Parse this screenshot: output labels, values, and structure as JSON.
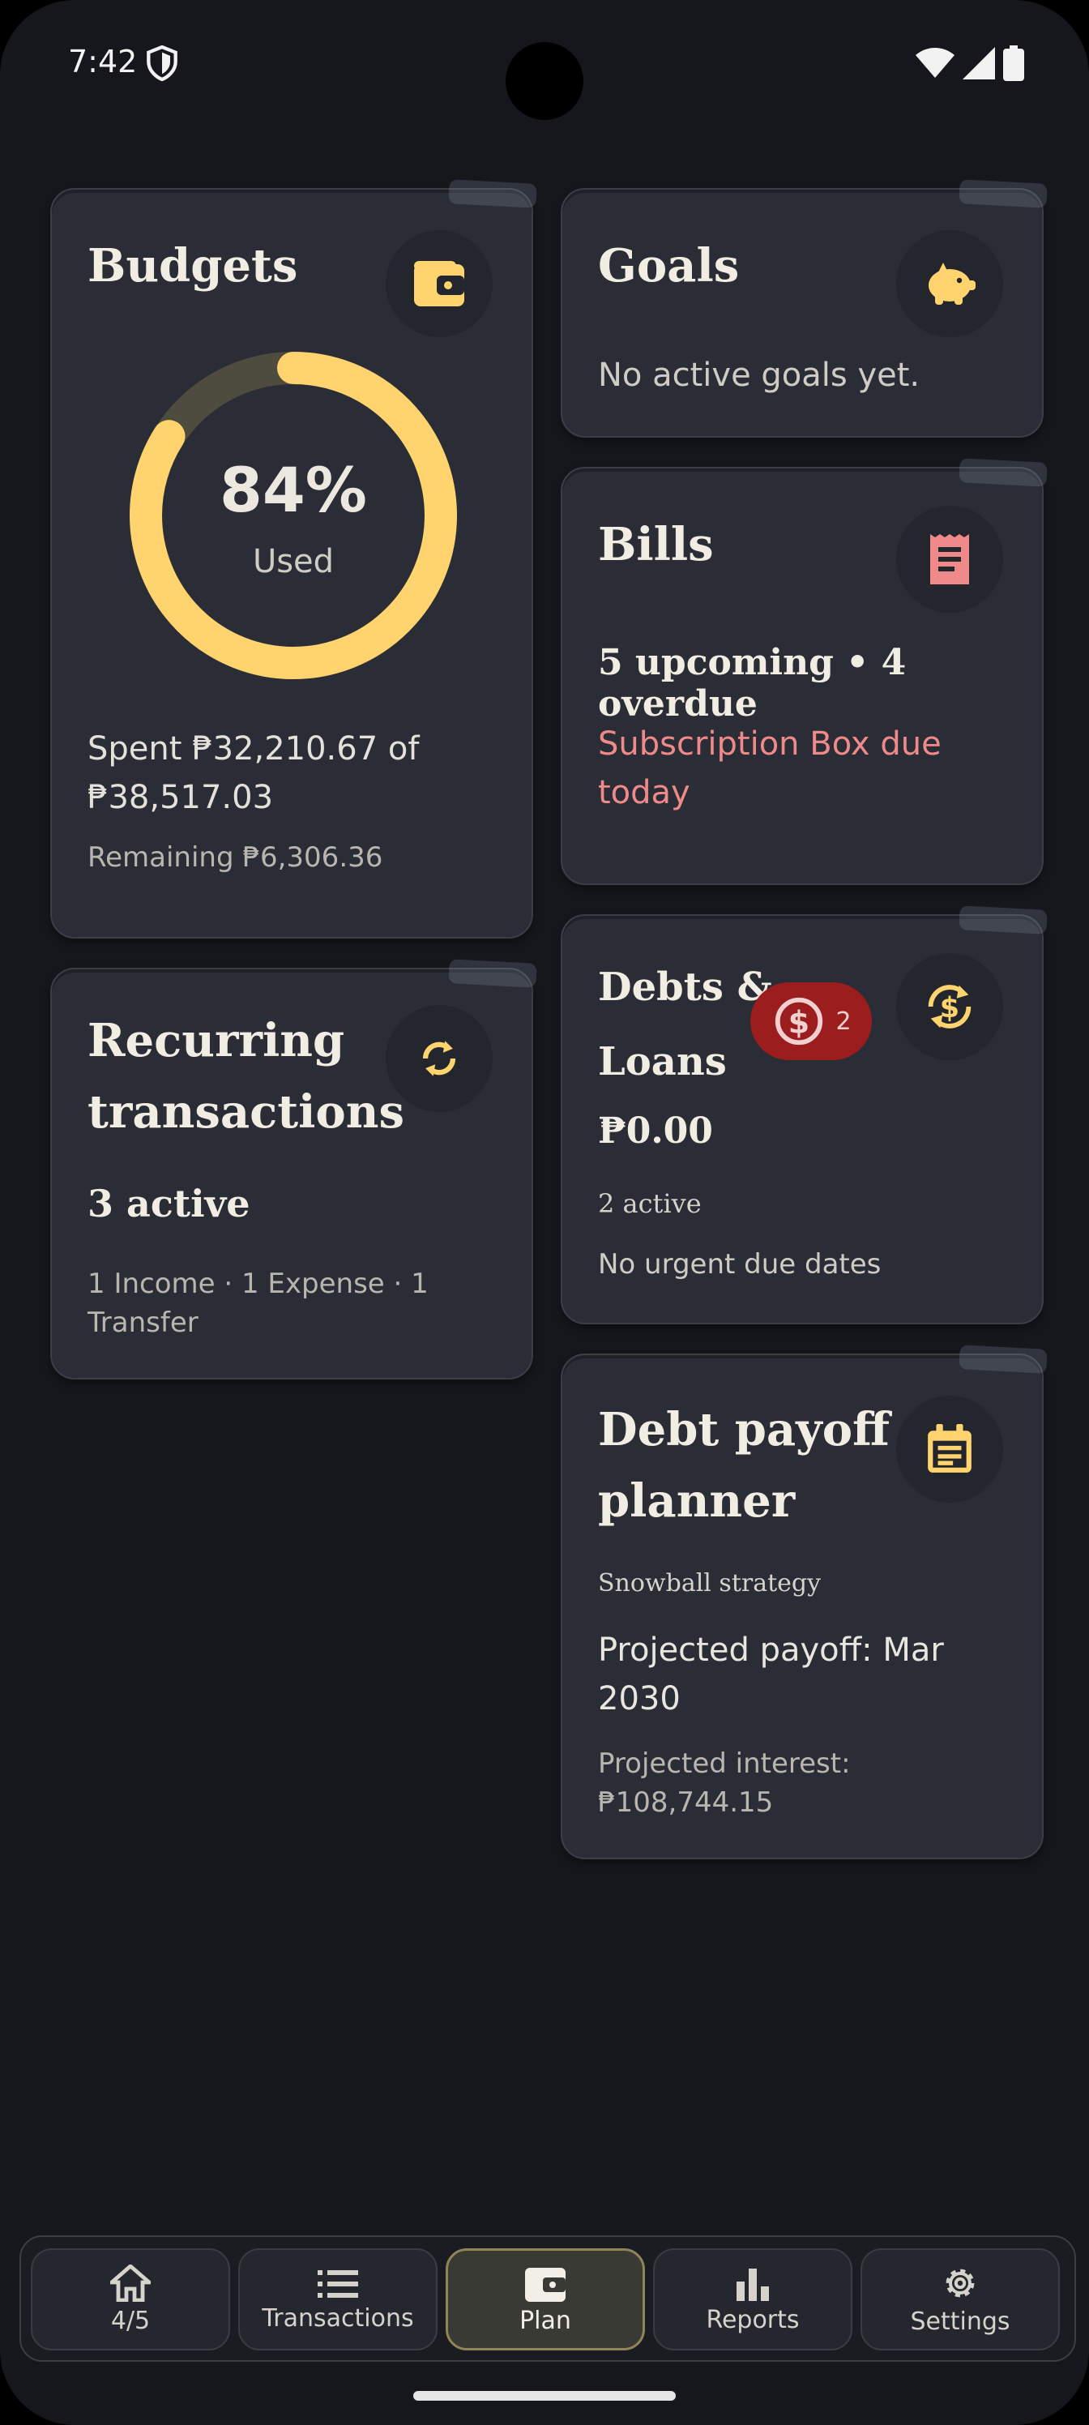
{
  "status_bar": {
    "time": "7:42"
  },
  "colors": {
    "accent": "#ffd36e",
    "alert": "#f08a8a",
    "badge_bg": "#9c1d1d",
    "card_bg": "#2a2d35",
    "page_bg": "#15171d"
  },
  "budgets": {
    "title": "Budgets",
    "icon": "wallet-icon",
    "percent_label": "84%",
    "percent_value": 84,
    "used_label": "Used",
    "spent_line1": "Spent ₱32,210.67 of",
    "spent_line2": "₱38,517.03",
    "remaining": "Remaining ₱6,306.36"
  },
  "goals": {
    "title": "Goals",
    "icon": "piggy-bank-icon",
    "message": "No active goals yet."
  },
  "bills": {
    "title": "Bills",
    "icon": "receipt-icon",
    "summary": "5 upcoming • 4 overdue",
    "alert_line1": "Subscription Box due",
    "alert_line2": "today"
  },
  "debts": {
    "title_line1": "Debts &",
    "title_line2": "Loans",
    "icon": "currency-exchange-icon",
    "badge_count": "2",
    "amount": "₱0.00",
    "active": "2 active",
    "due_status": "No urgent due dates"
  },
  "recurring": {
    "title_line1": "Recurring",
    "title_line2": "transactions",
    "icon": "refresh-icon",
    "active": "3 active",
    "breakdown_line1": "1 Income · 1 Expense · 1",
    "breakdown_line2": "Transfer"
  },
  "payoff": {
    "title_line1": "Debt payoff",
    "title_line2": "planner",
    "icon": "calendar-icon",
    "strategy": "Snowball strategy",
    "projected_line1": "Projected payoff: Mar",
    "projected_line2": "2030",
    "interest_line1": "Projected interest:",
    "interest_line2": "₱108,744.15"
  },
  "nav": {
    "items": [
      {
        "label": "4/5",
        "icon": "home-icon"
      },
      {
        "label": "Transactions",
        "icon": "list-icon"
      },
      {
        "label": "Plan",
        "icon": "wallet-icon",
        "active": true
      },
      {
        "label": "Reports",
        "icon": "bar-chart-icon"
      },
      {
        "label": "Settings",
        "icon": "gear-icon"
      }
    ]
  }
}
